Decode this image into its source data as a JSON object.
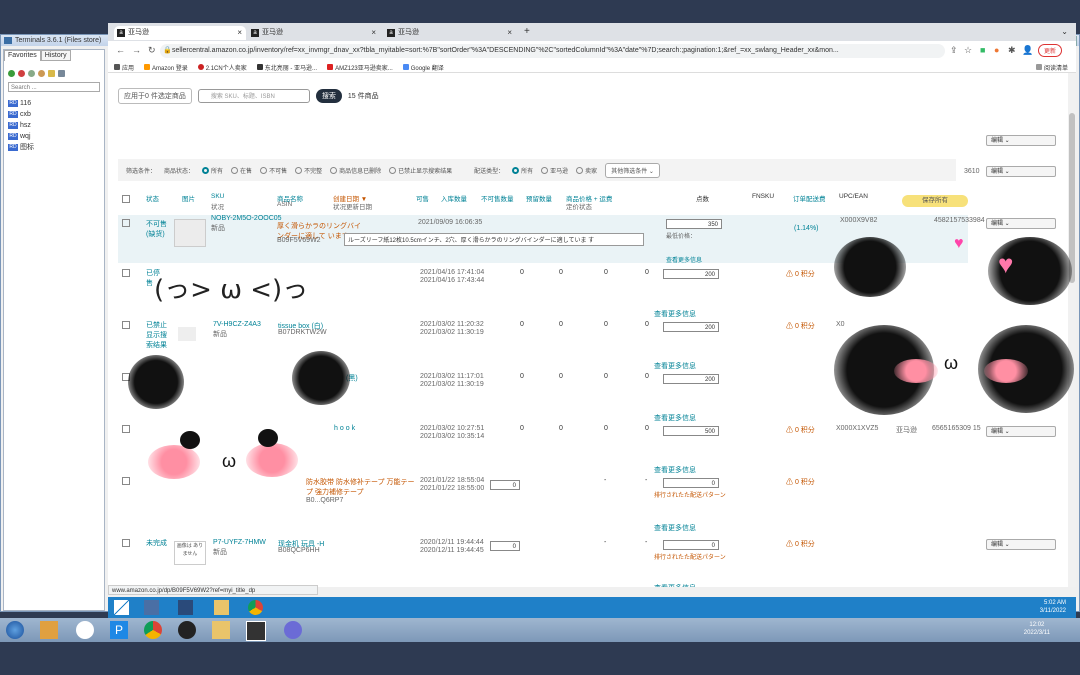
{
  "terminal": {
    "title": "Terminals 3.6.1 (Files store)",
    "tabs": [
      "Favorites",
      "History"
    ],
    "search_placeholder": "Search ...",
    "tree": [
      "116",
      "cxb",
      "hsz",
      "wqj",
      "图标"
    ],
    "session_tabs": [
      "116",
      "wqj"
    ]
  },
  "browser": {
    "tabs": [
      {
        "label": "亚马逊",
        "active": true
      },
      {
        "label": "亚马逊",
        "active": false
      },
      {
        "label": "亚马逊",
        "active": false
      }
    ],
    "url": "sellercentral.amazon.co.jp/inventory/ref=xx_invmgr_dnav_xx?tbla_myitable=sort:%7B\"sortOrder\"%3A\"DESCENDING\"%2C\"sortedColumnId\"%3A\"date\"%7D;search:;pagination:1;&ref_=xx_swlang_Header_xx&mon...",
    "bookmarks": [
      "应用",
      "Amazon 登录",
      "2.1CN个人卖家",
      "东北亮丽 - 亚马逊...",
      "AMZ123亚马逊卖家...",
      "Google 翻译"
    ],
    "bookmark_right": "阅读清单",
    "profile_btn": "更新"
  },
  "filters": {
    "apply_label": "应用于0 件选定商品",
    "search_placeholder": "搜索 SKU、标题、ISBN",
    "search_btn": "搜索",
    "result_count": "15 件商品",
    "filter_label": "筛选条件：",
    "status_label": "商品状态：",
    "status_options": [
      "所有",
      "在售",
      "不可售",
      "不完整",
      "商品信息已删除",
      "已禁止显示搜索结果"
    ],
    "fulfil_label": "配送类型：",
    "fulfil_options": [
      "所有",
      "亚马逊",
      "卖家"
    ],
    "more_filters": "其他筛选条件"
  },
  "columns": {
    "status": "状态",
    "image": "图片",
    "sku": "SKU",
    "sku_sub": "状况",
    "name": "商品名称",
    "name_sub": "ASIN",
    "created": "创建日期",
    "created_sub": "状况更新日期",
    "available": "可售",
    "inbound": "入库数量",
    "unfulfillable": "不可售数量",
    "reserved": "预留数量",
    "price": "商品价格 + 运费",
    "price_sub": "定价状态",
    "points": "点数",
    "fnsku": "FNSKU",
    "fee": "订单配送费",
    "upc": "UPC/EAN",
    "save_all": "保存所有"
  },
  "rows": [
    {
      "status": "不可售(缺货)",
      "sku": "NOBY-2M5O-2OOC05",
      "condition": "新品",
      "name": "厚く滑らかラのリングバインダーに適して います",
      "asin": "B09F5V69W2",
      "created": "2021/09/09 16:06:35",
      "updated": "2021/09/09 16:06:35",
      "price": "350",
      "fee": "(1.14%)",
      "upc": "4582157533984",
      "fnsku": "X000X9V82",
      "edit": "编辑"
    },
    {
      "status": "已停售",
      "sku": "",
      "condition": "",
      "name": "",
      "asin": "",
      "created": "2021/04/16 17:41:04",
      "updated": "2021/04/16 17:43:44",
      "available": "0",
      "inbound": "0",
      "unfulfillable": "0",
      "reserved": "0",
      "price": "200",
      "points": "0 积分",
      "edit": "编辑"
    },
    {
      "status": "已禁止显示搜索结果",
      "sku": "7V-H9CZ-Z4A3",
      "condition": "新品",
      "name": "tissue box (白)",
      "asin": "B07DRKTW2W",
      "created": "2021/03/02 11:20:32",
      "updated": "2021/03/02 11:30:19",
      "available": "0",
      "inbound": "0",
      "unfulfillable": "0",
      "reserved": "0",
      "price": "200",
      "points": "0 积分",
      "fnsku": "X0",
      "edit": "编辑"
    },
    {
      "status": "",
      "sku": "",
      "condition": "",
      "name": "(黑)",
      "asin": "",
      "created": "2021/03/02 11:17:01",
      "updated": "2021/03/02 11:30:19",
      "available": "0",
      "inbound": "0",
      "unfulfillable": "0",
      "reserved": "0",
      "price": "200",
      "points": "",
      "edit": ""
    },
    {
      "status": "",
      "sku": "",
      "condition": "",
      "name": "hook",
      "asin": "",
      "created": "2021/03/02 10:27:51",
      "updated": "2021/03/02 10:35:14",
      "available": "0",
      "inbound": "0",
      "unfulfillable": "0",
      "reserved": "0",
      "price": "500",
      "points": "0 积分",
      "fnsku": "X000X1XVZ5",
      "seller": "亚马逊",
      "upc": "6565165309 15",
      "edit": "编辑"
    },
    {
      "status": "",
      "sku": "",
      "condition": "",
      "name": "防水胶带 防水修补テープ 万能テープ 強力補修テープ",
      "asin": "B0...Q6RP7",
      "created": "2021/01/22 18:55:04",
      "updated": "2021/01/22 18:55:00",
      "qty": "0",
      "available": "-",
      "reserved": "-",
      "price": "0",
      "points": "0 积分",
      "note": "排行されたた配送パターン",
      "edit": ""
    },
    {
      "status": "未完成",
      "sku": "P7-UYFZ-7HMW",
      "condition": "新品",
      "name": "现金机 玩具 -H",
      "asin": "B08QCP6HH",
      "created": "2020/12/11 19:44:44",
      "updated": "2020/12/11 19:44:45",
      "qty": "0",
      "available": "-",
      "reserved": "-",
      "price": "0",
      "points": "0 积分",
      "note": "排行されたた配送パターン",
      "edit": "编辑",
      "no_image": "画像は ありません"
    }
  ],
  "row_common": {
    "lowest": "最低价格：",
    "lowest2": "最低价格：",
    "more": "查看更多信息",
    "tooltip": "ルーズリーフ紙12枚10.5cmインチ、2穴、厚く滑らかラのリングバインダーに適していま す"
  },
  "side_edits": [
    "编辑",
    "编辑",
    "编辑"
  ],
  "side_number": "3610",
  "status_bar": "www.amazon.co.jp/dp/B09F5V69W2?ref=myi_title_dp",
  "inner_clock": {
    "time": "5:02 AM",
    "date": "3/11/2022"
  },
  "outer_clock": {
    "time": "12:02",
    "date": "2022/3/11"
  },
  "stickers": {
    "kaomoji": "(っ> ω <)っ"
  }
}
